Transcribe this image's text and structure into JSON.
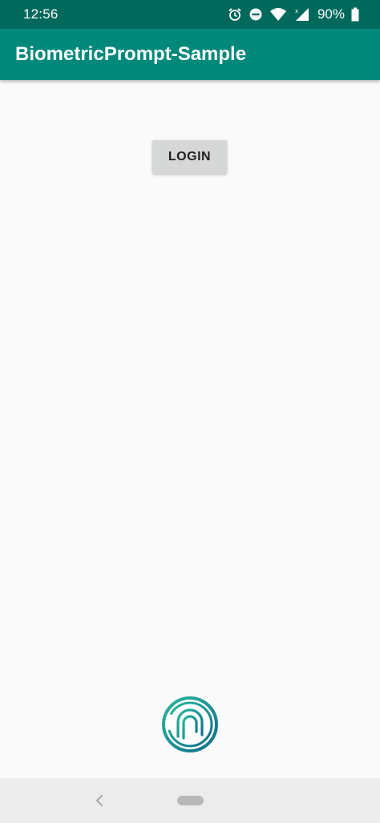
{
  "status_bar": {
    "time": "12:56",
    "battery_percent": "90%",
    "icons": [
      "alarm-icon",
      "do-not-disturb-icon",
      "wifi-icon",
      "signal-icon",
      "battery-icon"
    ]
  },
  "app_bar": {
    "title": "BiometricPrompt-Sample",
    "color": "#00897b",
    "status_color": "#00695c"
  },
  "main": {
    "login_button_label": "LOGIN",
    "logo_icon": "fingerprint-icon"
  },
  "nav_bar": {
    "icons": [
      "back-icon",
      "home-pill-icon"
    ]
  }
}
